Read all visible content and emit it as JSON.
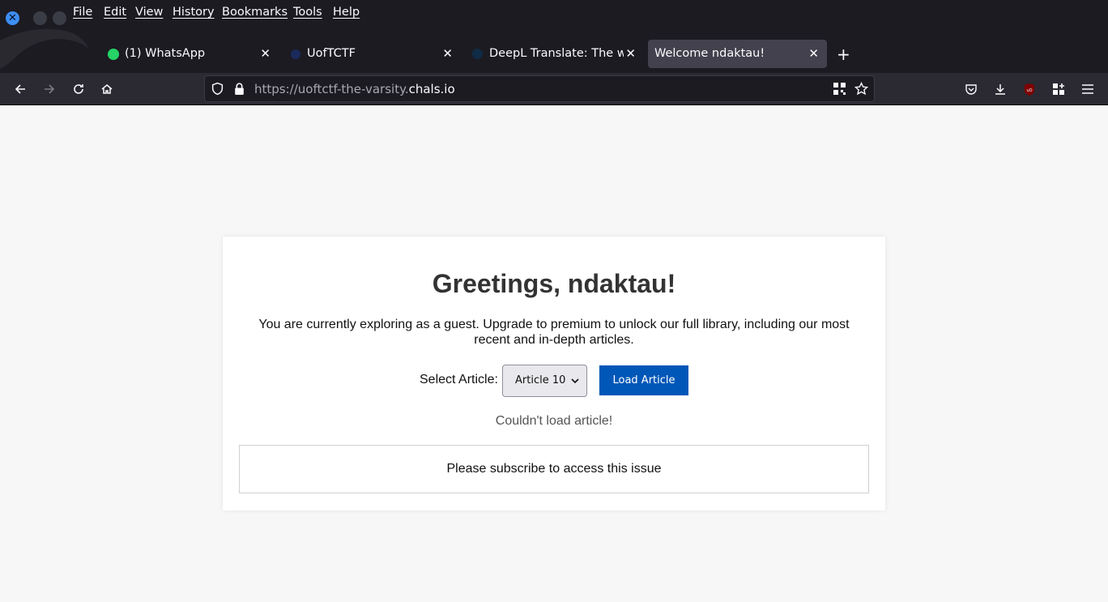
{
  "menubar": {
    "items": [
      "File",
      "Edit",
      "View",
      "History",
      "Bookmarks",
      "Tools",
      "Help"
    ]
  },
  "tabs": [
    {
      "title": "(1) WhatsApp",
      "favicon": "whatsapp-icon",
      "active": false
    },
    {
      "title": "UofTCTF",
      "favicon": "uoftctf-icon",
      "active": false
    },
    {
      "title": "DeepL Translate: The wor",
      "favicon": "deepl-icon",
      "active": false
    },
    {
      "title": "Welcome ndaktau!",
      "favicon": "",
      "active": true
    }
  ],
  "urlbar": {
    "prefix": "https://uoftctf-the-varsity.",
    "host": "chals.io"
  },
  "page": {
    "title": "Greetings, ndaktau!",
    "description": "You are currently exploring as a guest. Upgrade to premium to unlock our full library, including our most recent and in-depth articles.",
    "select_label": "Select Article:",
    "selected_article": "Article 10",
    "load_button": "Load Article",
    "error_message": "Couldn't load article!",
    "issue_message": "Please subscribe to access this issue"
  },
  "colors": {
    "chrome_bg": "#1c1b22",
    "navbar_bg": "#2b2a33",
    "active_tab": "#42414d",
    "primary_button": "#0057b8",
    "page_bg": "#f7f7f7"
  }
}
